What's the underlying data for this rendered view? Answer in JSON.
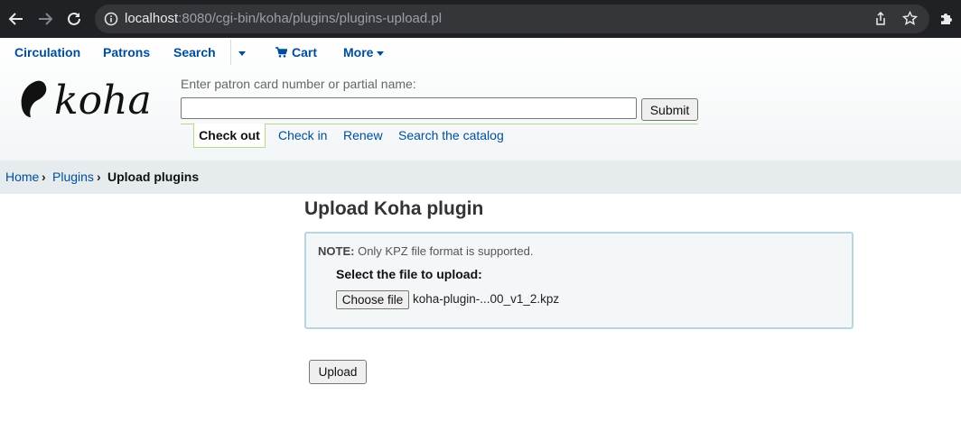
{
  "browser": {
    "url_host": "localhost",
    "url_path": ":8080/cgi-bin/koha/plugins/plugins-upload.pl"
  },
  "topnav": {
    "circulation": "Circulation",
    "patrons": "Patrons",
    "search": "Search",
    "cart": "Cart",
    "more": "More"
  },
  "logo_text": "koha",
  "patron_search": {
    "label": "Enter patron card number or partial name:",
    "value": "",
    "submit": "Submit"
  },
  "tabs": {
    "check_out": "Check out",
    "check_in": "Check in",
    "renew": "Renew",
    "search_catalog": "Search the catalog"
  },
  "breadcrumb": {
    "home": "Home",
    "plugins": "Plugins",
    "current": "Upload plugins",
    "separator": "›"
  },
  "main": {
    "title": "Upload Koha plugin",
    "note_label": "NOTE:",
    "note_text": "Only KPZ file format is supported.",
    "select_label": "Select the file to upload:",
    "choose_file": "Choose file",
    "file_name": "koha-plugin-...00_v1_2.kpz",
    "upload": "Upload"
  },
  "colors": {
    "link": "#004d99",
    "chrome_bg": "#202124",
    "panel_border": "#b8d6e2",
    "tab_border": "#b9d98a"
  }
}
